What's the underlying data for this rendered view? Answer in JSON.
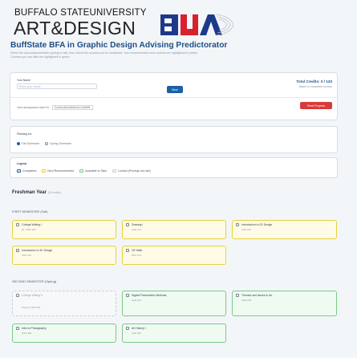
{
  "header": {
    "logo_top": "BUFFALO STATEUNIVERSITY",
    "logo_main": "ART&DESIGN",
    "app_title": "BuffState BFA in Graphic Design Advising Predictorator",
    "subtitle_line1": "Select the upcoming semester (spring or fall), then check the courses you've completed. Your recommended next courses are highlighted in yellow.",
    "subtitle_line2": "Courses you can take are highlighted in green."
  },
  "controls": {
    "name_label": "Your Name",
    "name_placeholder": "Enter your name",
    "go_label": "Save",
    "credits_label": "Total Credits: 0 / 120",
    "credits_sub": "Based on completed courses",
    "user_id_label": "Your anonymous User ID:",
    "user_id_value": "f1ca0cc8c0a6dbe0c1c5e8f1",
    "reset_label": "Reset Progress"
  },
  "planning": {
    "label": "Planning for:",
    "options": [
      "Fall Semester",
      "Spring Semester"
    ]
  },
  "legend": {
    "title": "Legend",
    "items": [
      "Completed",
      "Next Recommended",
      "Available to Take",
      "Locked (Prereqs not met)"
    ]
  },
  "year1": {
    "title": "Freshman Year",
    "sub": "(30 credits)",
    "fall_label": "FIRST SEMESTER (Fall)",
    "spring_label": "SECOND SEMESTER (Spring)"
  },
  "fall_courses": [
    {
      "title": "College Writing I",
      "code": "ID: CWP 101*",
      "state": "yellow"
    },
    {
      "title": "Drawing I",
      "code": "AAD 101",
      "state": "yellow"
    },
    {
      "title": "Introduction to 2D Design",
      "code": "AAD 102",
      "state": "yellow"
    },
    {
      "title": "Introduction to 3D Design",
      "code": "AAD 103",
      "state": "yellow"
    },
    {
      "title": "GE Math",
      "code": "MAT 1XX",
      "state": "yellow"
    }
  ],
  "spring_courses": [
    {
      "title": "College Writing II",
      "code": "Prereq: CWP 101",
      "state": "gray"
    },
    {
      "title": "Digital Presentation Methods",
      "code": "AAD 104",
      "state": "green"
    },
    {
      "title": "Themes and Issues in Art",
      "code": "AAD 150",
      "state": "green"
    },
    {
      "title": "Intro to Photography",
      "code": "PHO 200",
      "state": "green"
    },
    {
      "title": "Art History I",
      "code": "AAD 251",
      "state": "green"
    }
  ],
  "colors": {
    "accent": "#1d5fa8",
    "title": "#1f4f86",
    "danger": "#d83b3b",
    "next": "#e6d23a",
    "available": "#7cc98a",
    "logo_blue": "#1d3a8a",
    "logo_red": "#d8202e"
  }
}
